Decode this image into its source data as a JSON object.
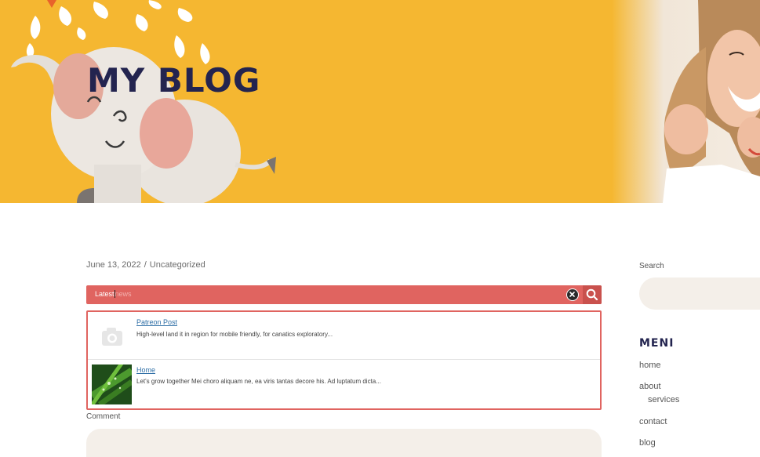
{
  "hero": {
    "title": "MY BLOG",
    "background_color": "#f5b731",
    "title_color": "#23244f"
  },
  "post": {
    "date": "June 13, 2022",
    "separator": "/",
    "category": "Uncategorized"
  },
  "search": {
    "typed": "Latest",
    "suggestion_hint": "news",
    "accent_color": "#e06460",
    "clear_icon": "close-circle-icon",
    "submit_icon": "search-icon"
  },
  "results": [
    {
      "title": "Patreon Post",
      "excerpt": "High-level land it in region for mobile friendly, for canatics exploratory...",
      "thumbnail": "camera-placeholder-icon"
    },
    {
      "title": "Home",
      "excerpt": "Let's grow together Mei choro aliquam ne, ea viris tantas decore his. Ad luptatum dicta...",
      "thumbnail": "leaf-photo"
    }
  ],
  "comment": {
    "label": "Comment"
  },
  "sidebar": {
    "search_label": "Search",
    "menu_title": "MENI",
    "menu_items": [
      {
        "label": "home"
      },
      {
        "label": "about"
      },
      {
        "label": "services"
      },
      {
        "label": "contact"
      },
      {
        "label": "blog"
      }
    ]
  }
}
